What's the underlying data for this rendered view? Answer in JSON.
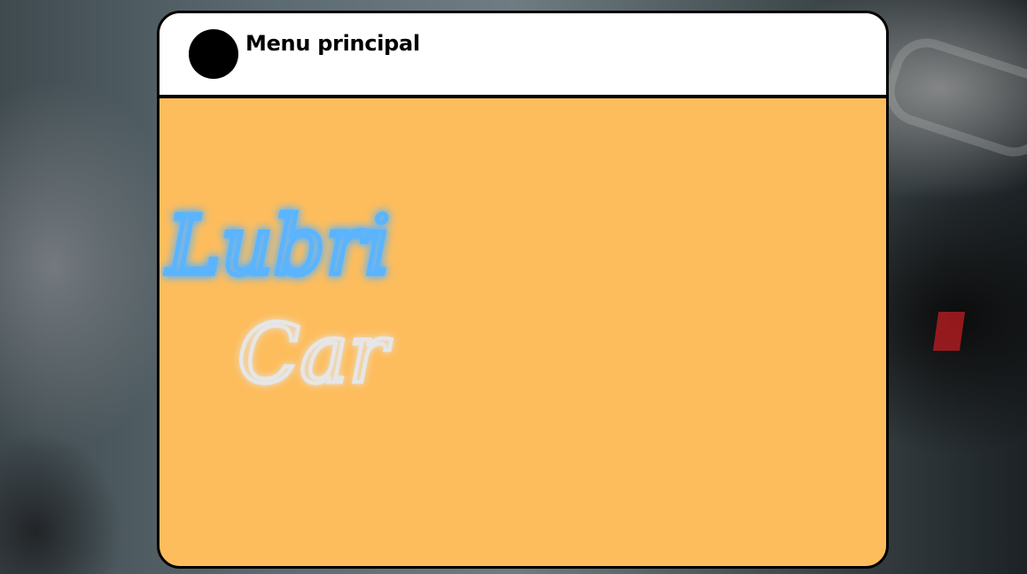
{
  "header": {
    "title": "Menu principal"
  },
  "logo": {
    "line1": "Lubri",
    "line2": "Car"
  },
  "colors": {
    "panel_background": "#fdbd5d",
    "header_background": "#ffffff",
    "logo_line1": "#5ab4ff",
    "logo_line2": "#e6e6e6"
  }
}
